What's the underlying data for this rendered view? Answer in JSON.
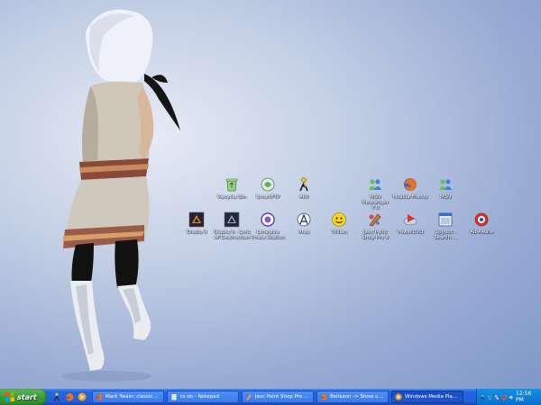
{
  "desktop": {
    "icons": [
      {
        "label": "Recycle Bin",
        "icon": "recycle-bin-icon"
      },
      {
        "label": "SmartFTP",
        "icon": "smartftp-icon"
      },
      {
        "label": "AIM",
        "icon": "aim-icon"
      },
      {
        "label": "MSN Messenger 7.0",
        "icon": "msn-messenger-icon"
      },
      {
        "label": "Mozilla Firefox",
        "icon": "firefox-icon"
      },
      {
        "label": "MSN",
        "icon": "msn-icon"
      },
      {
        "label": "Diablo II",
        "icon": "diablo-icon"
      },
      {
        "label": "Diablo II - Lord of Destruction",
        "icon": "diablo-lod-icon"
      },
      {
        "label": "Limewire Pirate Station",
        "icon": "limewire-icon"
      },
      {
        "label": "Ares",
        "icon": "ares-icon"
      },
      {
        "label": "Trillian",
        "icon": "trillian-icon"
      },
      {
        "label": "Jasc Paint Shop Pro 9",
        "icon": "paint-shop-pro-icon"
      },
      {
        "label": "PowerDVD",
        "icon": "powerdvd-icon"
      },
      {
        "label": "Spybot - Search ...",
        "icon": "spybot-icon"
      },
      {
        "label": "Ad-Aware",
        "icon": "adaware-icon"
      }
    ]
  },
  "taskbar": {
    "start_label": "start",
    "quicklaunch": [
      "aim-icon",
      "firefox-icon",
      "media-player-icon"
    ],
    "tasks": [
      {
        "label": "Mark Twain; classic...",
        "icon": "firefox-icon",
        "active": false
      },
      {
        "label": "to do - Notepad",
        "icon": "notepad-icon",
        "active": false
      },
      {
        "label": "Jasc Paint Shop Pro - ...",
        "icon": "paint-shop-pro-icon",
        "active": false
      },
      {
        "label": "Bellazon -> Show us ...",
        "icon": "firefox-icon",
        "active": false
      },
      {
        "label": "Windows Media Player",
        "icon": "media-player-icon",
        "active": true
      }
    ],
    "clock": "12:56 PM"
  },
  "colors": {
    "taskbar_blue": "#245edb",
    "start_green": "#3c9b38",
    "tray_blue": "#0c80dd"
  }
}
